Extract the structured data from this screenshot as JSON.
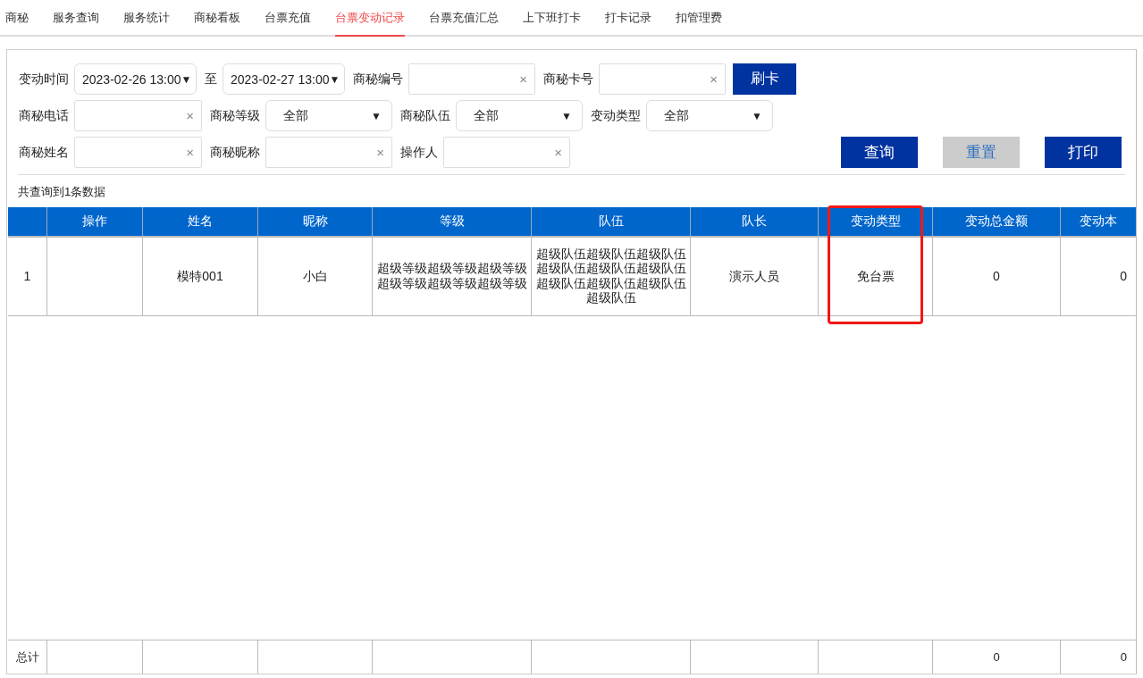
{
  "tabs": [
    {
      "label": "商秘",
      "selected": false
    },
    {
      "label": "服务查询",
      "selected": false
    },
    {
      "label": "服务统计",
      "selected": false
    },
    {
      "label": "商秘看板",
      "selected": false
    },
    {
      "label": "台票充值",
      "selected": false
    },
    {
      "label": "台票变动记录",
      "selected": true
    },
    {
      "label": "台票充值汇总",
      "selected": false
    },
    {
      "label": "上下班打卡",
      "selected": false
    },
    {
      "label": "打卡记录",
      "selected": false
    },
    {
      "label": "扣管理费",
      "selected": false
    }
  ],
  "filter_rows": [
    [
      {
        "kind": "date",
        "label": "变动时间",
        "value": "2023-02-26 13:00",
        "arrow": "▼"
      },
      {
        "kind": "date",
        "label": "至",
        "value": "2023-02-27 13:00",
        "arrow": "▼"
      },
      {
        "kind": "text",
        "label": "商秘编号",
        "clear": "×"
      },
      {
        "kind": "text",
        "label": "商秘卡号",
        "clear": "×"
      },
      {
        "kind": "button",
        "label": "刷卡"
      }
    ],
    [
      {
        "kind": "text",
        "label": "商秘电话",
        "clear": "×"
      },
      {
        "kind": "select",
        "label": "商秘等级",
        "value": "全部",
        "arrow": "▼"
      },
      {
        "kind": "select",
        "label": "商秘队伍",
        "value": "全部",
        "arrow": "▼"
      },
      {
        "kind": "select",
        "label": "变动类型",
        "value": "全部",
        "arrow": "▼"
      }
    ],
    [
      {
        "kind": "text",
        "label": "商秘姓名",
        "clear": "×"
      },
      {
        "kind": "text",
        "label": "商秘昵称",
        "clear": "×"
      },
      {
        "kind": "text",
        "label": "操作人",
        "clear": "×"
      }
    ]
  ],
  "actions": [
    {
      "label": "查询",
      "kind": "primary"
    },
    {
      "label": "重置",
      "kind": "secondary"
    },
    {
      "label": "打印",
      "kind": "primary"
    }
  ],
  "result_count": "共查询到1条数据",
  "table": {
    "columns": [
      {
        "label": "操作",
        "highlighted": false
      },
      {
        "label": "姓名",
        "highlighted": false
      },
      {
        "label": "昵称",
        "highlighted": false
      },
      {
        "label": "等级",
        "highlighted": false
      },
      {
        "label": "队伍",
        "highlighted": false
      },
      {
        "label": "队长",
        "highlighted": false
      },
      {
        "label": "变动类型",
        "highlighted": true
      },
      {
        "label": "变动总金额",
        "highlighted": false
      },
      {
        "label": "变动本",
        "highlighted": false
      }
    ],
    "rows": [
      {
        "index": "1",
        "cells": [
          null,
          "模特001",
          "小白",
          "超级等级超级等级超级等级超级等级超级等级超级等级",
          "超级队伍超级队伍超级队伍超级队伍超级队伍超级队伍超级队伍超级队伍超级队伍超级队伍",
          "演示人员",
          "免台票",
          "0",
          "0"
        ]
      }
    ],
    "footer": {
      "label": "总计",
      "totals": [
        "0",
        "0"
      ]
    }
  }
}
